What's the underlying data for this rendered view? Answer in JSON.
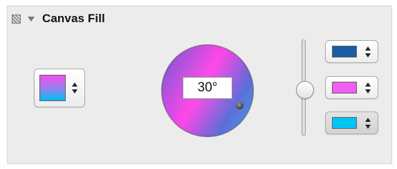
{
  "panel": {
    "title": "Canvas Fill",
    "icons": {
      "fill": "hatched-square-icon",
      "disclosure": "triangle-down-icon"
    }
  },
  "gradient_well": {
    "colors": [
      "#f24ff0",
      "#00bff5"
    ],
    "stepper_icon": "up-down-arrows-icon"
  },
  "angle_dial": {
    "value": "30°",
    "angle_degrees": 30,
    "colors": [
      "#6a5bd6",
      "#ff45e8",
      "#5b6cd8",
      "#4fa3ea"
    ]
  },
  "slider": {
    "value": 0.5
  },
  "color_stops": [
    {
      "color": "#1a5da3",
      "selected": false
    },
    {
      "color": "#f25df3",
      "selected": false
    },
    {
      "color": "#00c4f3",
      "selected": true
    }
  ]
}
